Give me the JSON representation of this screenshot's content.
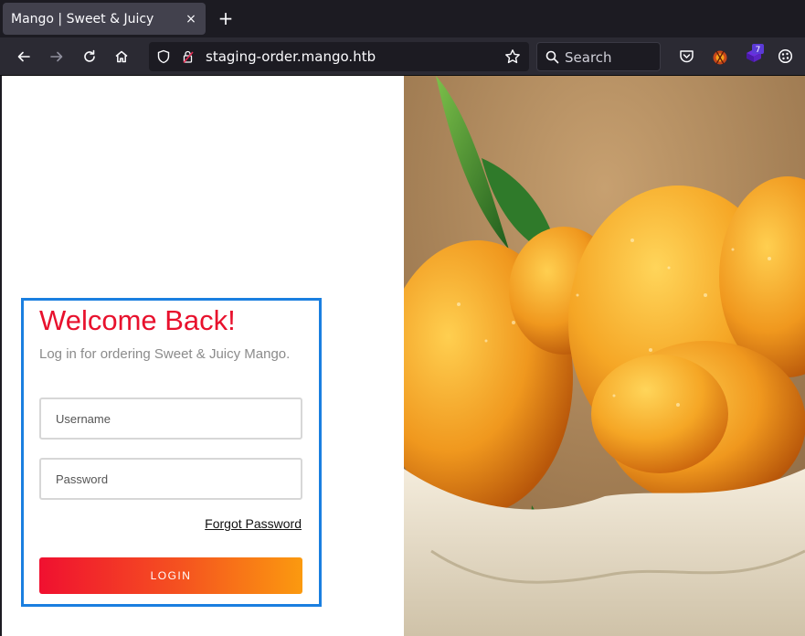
{
  "browser": {
    "tab_title": "Mango | Sweet & Juicy",
    "tab_close": "×",
    "new_tab": "+",
    "url": "staging-order.mango.htb",
    "search_placeholder": "Search",
    "extension_badge": "7"
  },
  "login": {
    "heading": "Welcome Back!",
    "subtitle": "Log in for ordering Sweet & Juicy Mango.",
    "username_placeholder": "Username",
    "password_placeholder": "Password",
    "forgot_label": "Forgot Password",
    "login_label": "LOGIN"
  },
  "colors": {
    "accent_red": "#e8112d",
    "card_border": "#1a7fe0",
    "button_gradient_start": "#f01030",
    "button_gradient_end": "#fb9a0f"
  },
  "icons": [
    "back-icon",
    "forward-icon",
    "reload-icon",
    "home-icon",
    "shield-icon",
    "lock-icon",
    "star-icon",
    "search-icon",
    "pocket-icon",
    "extension-icon",
    "extension-badge-icon",
    "extensions-puzzle-icon"
  ]
}
